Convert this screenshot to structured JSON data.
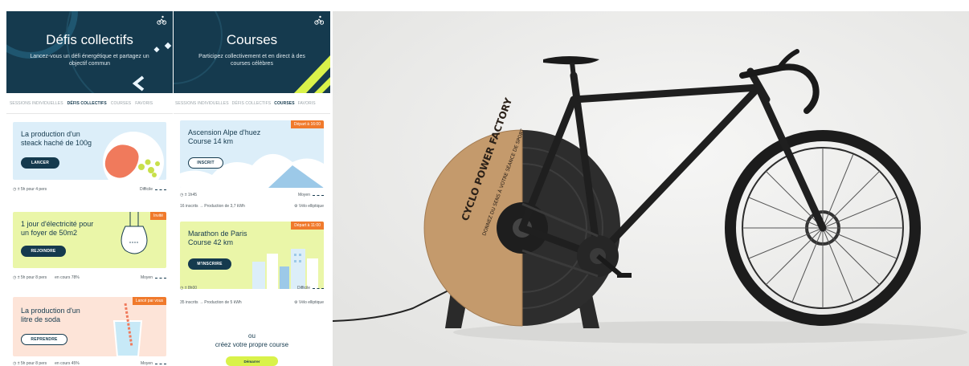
{
  "colors": {
    "navy": "#153a4e",
    "lime": "#d9f24a",
    "orange": "#f07a2c",
    "peach": "#fde4d8",
    "sky": "#dceef9",
    "limepale": "#eaf6a8"
  },
  "left_screen": {
    "hero_title": "Défis collectifs",
    "hero_sub": "Lancez-vous un défi énergétique et partagez un objectif commun",
    "tabs": [
      {
        "label": "Sessions individuelles",
        "active": false
      },
      {
        "label": "Défis collectifs",
        "active": true
      },
      {
        "label": "Courses",
        "active": false
      },
      {
        "label": "Favoris",
        "active": false
      }
    ],
    "cards": [
      {
        "title": "La production d'un steack haché de 100g",
        "button": "Lancer",
        "meta_left": "± 5h pour 4 pers",
        "meta_mid": "",
        "meta_right": "Difficile"
      },
      {
        "title": "1 jour d'électricité pour un foyer de 50m2",
        "badge": "Invité",
        "button": "Rejoindre",
        "meta_left": "± 5h pour 8 pers",
        "meta_mid": "en cours 78%",
        "meta_right": "Moyen"
      },
      {
        "title": "La production d'un litre de soda",
        "badge": "Lancé par vous",
        "button": "Reprendre",
        "meta_left": "± 5h pour 8 pers",
        "meta_mid": "en cours 45%",
        "meta_right": "Moyen"
      }
    ]
  },
  "right_screen": {
    "hero_title": "Courses",
    "hero_sub": "Participez collectivement et en direct à des courses célèbres",
    "tabs": [
      {
        "label": "Sessions individuelles",
        "active": false
      },
      {
        "label": "Défis collectifs",
        "active": false
      },
      {
        "label": "Courses",
        "active": true
      },
      {
        "label": "Favoris",
        "active": false
      }
    ],
    "cards": [
      {
        "title": "Ascension Alpe d'huez Course 14 km",
        "badge": "Départ à 16:00",
        "button": "Inscrit",
        "meta_top_left": "± 1h45",
        "meta_top_right": "Moyen",
        "meta_bottom_left": "16 inscrits → Production de 3,7 kWh",
        "meta_bottom_right": "Vélo elliptique"
      },
      {
        "title": "Marathon de Paris Course 42 km",
        "badge": "Départ à 11:00",
        "button": "M'inscrire",
        "meta_top_left": "± 8h00",
        "meta_top_right": "Difficile",
        "meta_bottom_left": "35 inscrits → Production de 5 kWh",
        "meta_bottom_right": "Vélo elliptique"
      }
    ],
    "cta_or": "ou",
    "cta_text": "créez votre propre course",
    "cta_button": "Démarrer"
  },
  "product": {
    "brand_line1": "CYCLO POWER FACTORY",
    "brand_line2": "DONNEZ DU SENS À VOTRE SÉANCE DE SPORT"
  }
}
